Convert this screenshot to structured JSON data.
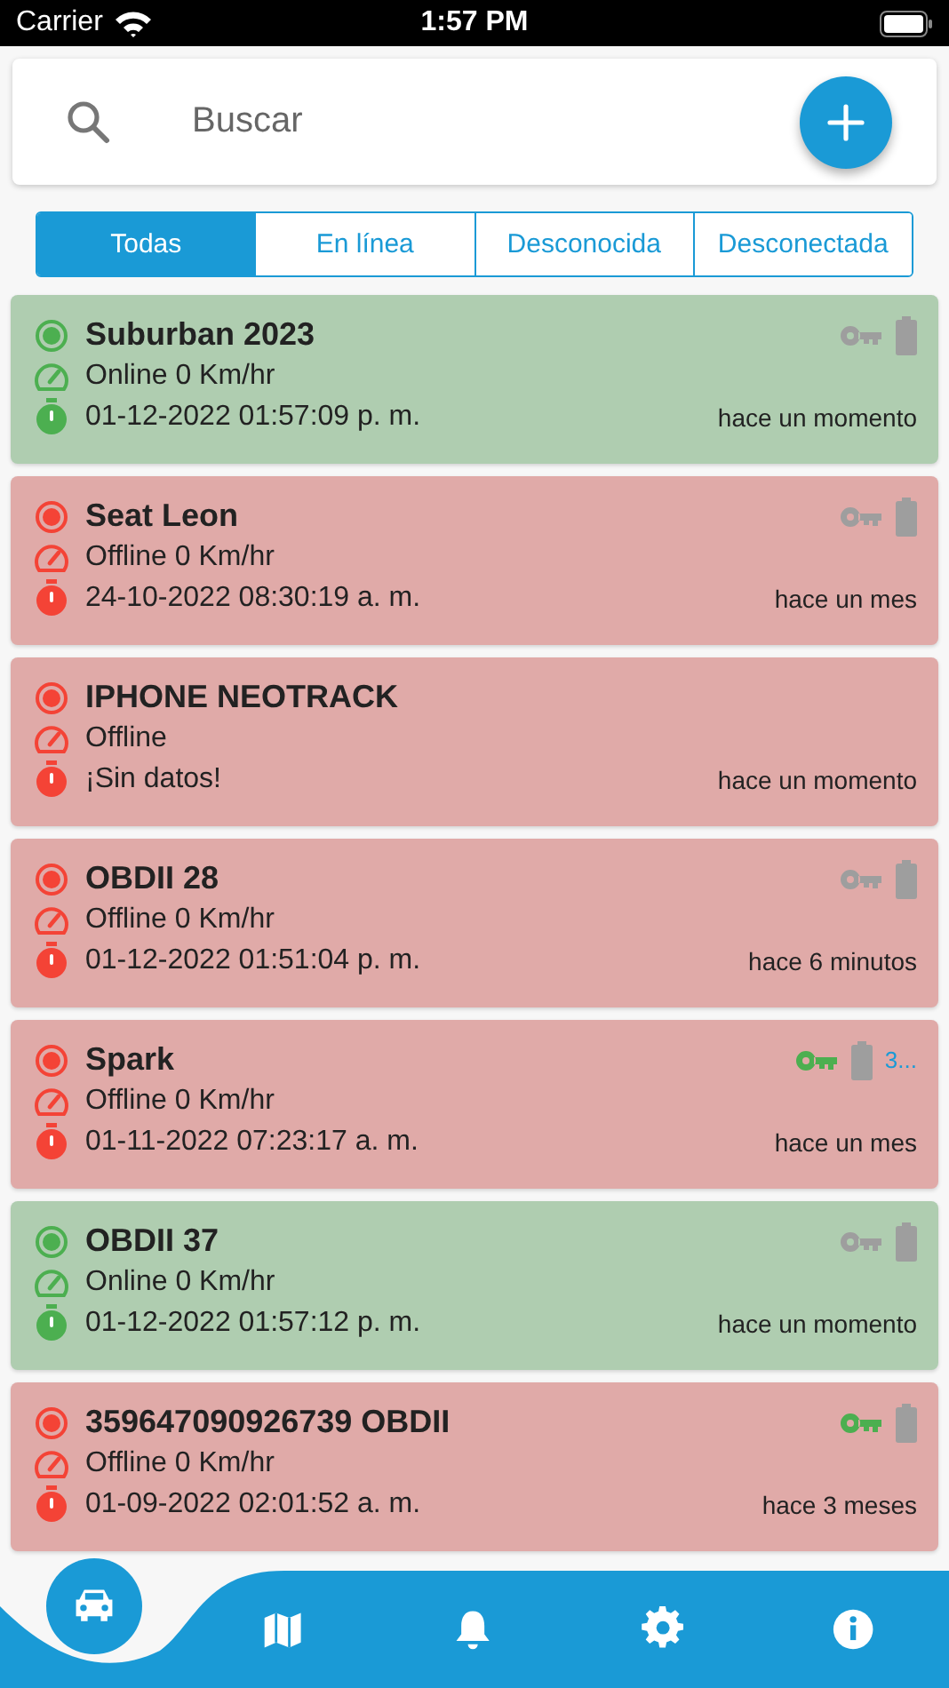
{
  "status_bar": {
    "carrier": "Carrier",
    "time": "1:57 PM"
  },
  "search": {
    "placeholder": "Buscar"
  },
  "filters": [
    {
      "label": "Todas",
      "selected": true
    },
    {
      "label": "En línea",
      "selected": false
    },
    {
      "label": "Desconocida",
      "selected": false
    },
    {
      "label": "Desconectada",
      "selected": false
    }
  ],
  "devices": [
    {
      "name": "Suburban 2023",
      "kind": "online",
      "speed": "Online 0 Km/hr",
      "datetime": "01-12-2022 01:57:09 p. m.",
      "ago": "hace un momento",
      "ignition": false
    },
    {
      "name": "Seat Leon",
      "kind": "offline",
      "speed": "Offline 0 Km/hr",
      "datetime": "24-10-2022 08:30:19 a. m.",
      "ago": "hace un mes",
      "ignition": false
    },
    {
      "name": "IPHONE NEOTRACK",
      "kind": "offline",
      "speed": "Offline",
      "datetime": "¡Sin datos!",
      "ago": "hace un momento"
    },
    {
      "name": "OBDII 28",
      "kind": "offline",
      "speed": "Offline 0 Km/hr",
      "datetime": "01-12-2022 01:51:04 p. m.",
      "ago": "hace 6 minutos",
      "ignition": false
    },
    {
      "name": "Spark",
      "kind": "offline",
      "speed": "Offline 0 Km/hr",
      "datetime": "01-11-2022 07:23:17 a. m.",
      "ago": "hace un mes",
      "ignition": true,
      "battery_note": "3..."
    },
    {
      "name": "OBDII 37",
      "kind": "online",
      "speed": "Online 0 Km/hr",
      "datetime": "01-12-2022 01:57:12 p. m.",
      "ago": "hace un momento",
      "ignition": false
    },
    {
      "name": "359647090926739 OBDII",
      "kind": "offline",
      "speed": "Offline 0 Km/hr",
      "datetime": "01-09-2022 02:01:52 a. m.",
      "ago": "hace 3 meses",
      "ignition": true
    }
  ],
  "nav": [
    {
      "kind": "car",
      "selected": true
    },
    {
      "kind": "map",
      "selected": false
    },
    {
      "kind": "bell",
      "selected": false
    },
    {
      "kind": "gear",
      "selected": false
    },
    {
      "kind": "info",
      "selected": false
    }
  ]
}
